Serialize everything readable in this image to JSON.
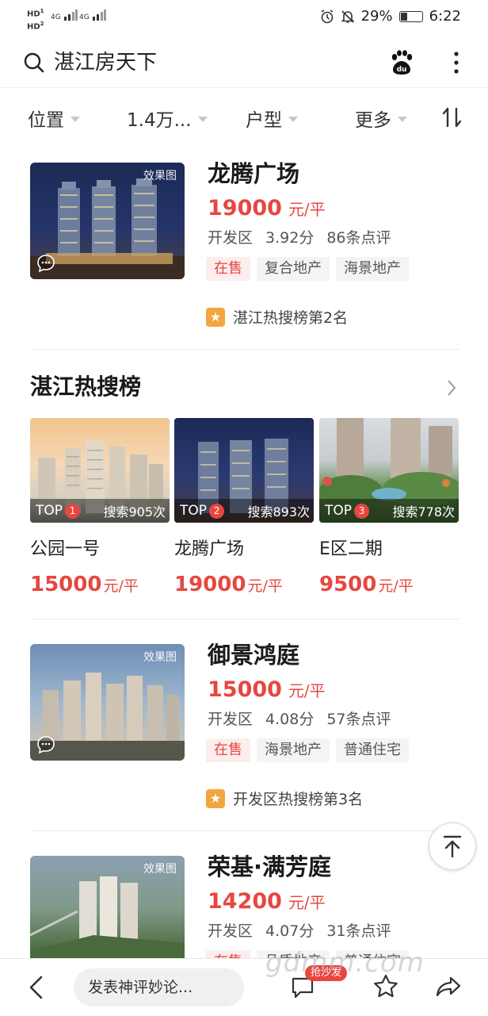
{
  "status_bar": {
    "hd1": "HD",
    "hd2": "HD",
    "net1": "4G",
    "net2": "4G",
    "battery": "29%",
    "time": "6:22",
    "icons": [
      "alarm-icon",
      "mute-bell-icon",
      "battery-icon"
    ]
  },
  "search": {
    "text": "湛江房天下",
    "icons": [
      "search-icon",
      "baidu-paw-icon",
      "more-vertical-icon"
    ]
  },
  "filters": [
    {
      "label": "位置"
    },
    {
      "label": "1.4万..."
    },
    {
      "label": "户型"
    },
    {
      "label": "更多"
    }
  ],
  "listings": [
    {
      "title": "龙腾广场",
      "badge": "效果图",
      "price": "19000",
      "unit": "元/平",
      "district": "开发区",
      "score": "3.92分",
      "reviews": "86条点评",
      "tags": [
        "在售",
        "复合地产",
        "海景地产"
      ],
      "rank": "湛江热搜榜第2名"
    },
    {
      "title": "御景鸿庭",
      "badge": "效果图",
      "price": "15000",
      "unit": "元/平",
      "district": "开发区",
      "score": "4.08分",
      "reviews": "57条点评",
      "tags": [
        "在售",
        "海景地产",
        "普通住宅"
      ],
      "rank": "开发区热搜榜第3名"
    },
    {
      "title": "荣基·满芳庭",
      "badge": "效果图",
      "price": "14200",
      "unit": "元/平",
      "district": "开发区",
      "score": "4.07分",
      "reviews": "31条点评",
      "tags": [
        "在售",
        "品质地产",
        "普通住宅"
      ]
    }
  ],
  "hot": {
    "title": "湛江热搜榜",
    "items": [
      {
        "top": "TOP",
        "rank": "1",
        "searches": "搜索905次",
        "name": "公园一号",
        "price": "15000",
        "unit": "元/平"
      },
      {
        "top": "TOP",
        "rank": "2",
        "searches": "搜索893次",
        "name": "龙腾广场",
        "price": "19000",
        "unit": "元/平"
      },
      {
        "top": "TOP",
        "rank": "3",
        "searches": "搜索778次",
        "name": "E区二期",
        "price": "9500",
        "unit": "元/平"
      }
    ]
  },
  "bottom_bar": {
    "comment_placeholder": "发表神评妙论...",
    "sofa_badge": "抢沙发",
    "watermark": "gdmm.com"
  },
  "colors": {
    "accent_red": "#e8463f",
    "rank_star": "#f3a640"
  }
}
